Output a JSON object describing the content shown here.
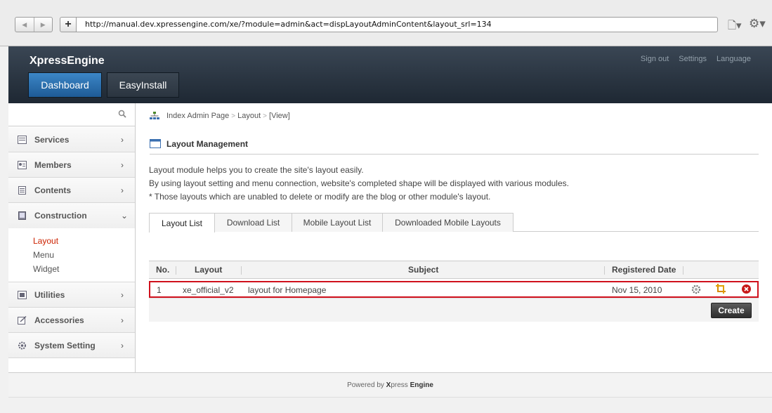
{
  "browser": {
    "back_glyph": "◀",
    "forward_glyph": "▶",
    "plus_glyph": "+",
    "url": "http://manual.dev.xpressengine.com/xe/?module=admin&act=dispLayoutAdminContent&layout_srl=134",
    "page_glyph": "🗋▾",
    "gear_glyph": "⚙▾"
  },
  "header": {
    "brand": "XpressEngine",
    "gnb": [
      "Dashboard",
      "EasyInstall"
    ],
    "account": [
      "Sign out",
      "Settings",
      "Language"
    ]
  },
  "sidebar": {
    "search_placeholder": "",
    "items": [
      {
        "label": "Services",
        "icon": "services-icon",
        "chevron": "›"
      },
      {
        "label": "Members",
        "icon": "members-icon",
        "chevron": "›"
      },
      {
        "label": "Contents",
        "icon": "contents-icon",
        "chevron": "›"
      },
      {
        "label": "Construction",
        "icon": "construction-icon",
        "chevron": "⌄"
      },
      {
        "label": "Utilities",
        "icon": "utilities-icon",
        "chevron": "›"
      },
      {
        "label": "Accessories",
        "icon": "accessories-icon",
        "chevron": "›"
      },
      {
        "label": "System Setting",
        "icon": "system-setting-icon",
        "chevron": "›"
      }
    ],
    "submenu": [
      "Layout",
      "Menu",
      "Widget"
    ]
  },
  "breadcrumb": [
    "Index Admin Page",
    "Layout",
    "[View]"
  ],
  "breadcrumb_sep": ">",
  "page_title": "Layout Management",
  "description": [
    "Layout module helps you to create the site's layout easily.",
    "By using layout setting and menu connection, website's completed shape will be displayed with various modules.",
    "* Those layouts which are unabled to delete or modify are the blog or other module's layout."
  ],
  "tabs": [
    "Layout List",
    "Download List",
    "Mobile Layout List",
    "Downloaded Mobile Layouts"
  ],
  "table": {
    "headers": [
      "No.",
      "Layout",
      "Subject",
      "Registered Date"
    ],
    "rows": [
      {
        "no": "1",
        "layout": "xe_official_v2",
        "subject": "layout for Homepage",
        "date": "Nov 15, 2010"
      }
    ],
    "create_label": "Create"
  },
  "footer": {
    "prefix": "Powered by",
    "brand1": "X",
    "brand2": "press",
    "brand3": "Engine"
  },
  "colors": {
    "accent": "#2f6fae",
    "highlight": "#d0111d",
    "current_menu": "#cc2200"
  }
}
